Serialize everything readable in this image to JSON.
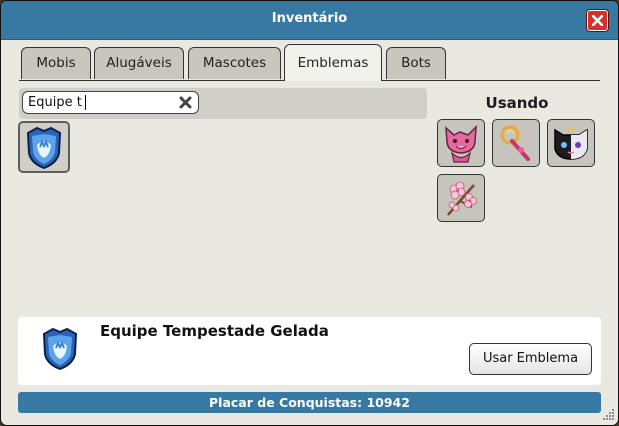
{
  "window": {
    "title": "Inventário"
  },
  "tabs": [
    {
      "label": "Mobis",
      "active": false
    },
    {
      "label": "Alugáveis",
      "active": false
    },
    {
      "label": "Mascotes",
      "active": false
    },
    {
      "label": "Emblemas",
      "active": true
    },
    {
      "label": "Bots",
      "active": false
    }
  ],
  "search": {
    "value": "Equipe t"
  },
  "badges": [
    {
      "icon": "blue-shield-badge-icon",
      "selected": true
    }
  ],
  "using": {
    "title": "Usando",
    "badges": [
      {
        "icon": "pink-cat-badge-icon"
      },
      {
        "icon": "magic-wand-badge-icon"
      },
      {
        "icon": "black-white-cat-badge-icon"
      },
      {
        "icon": "cherry-blossom-badge-icon"
      }
    ]
  },
  "selected_badge": {
    "name": "Equipe Tempestade Gelada",
    "icon": "blue-shield-badge-icon",
    "button_label": "Usar Emblema"
  },
  "footer": {
    "text": "Placar de Conquistas: 10942"
  },
  "colors": {
    "titlebar": "#3779a3",
    "window_bg": "#e9e9e1",
    "close_button": "#d7312d",
    "footer_bar": "#3779a3"
  }
}
